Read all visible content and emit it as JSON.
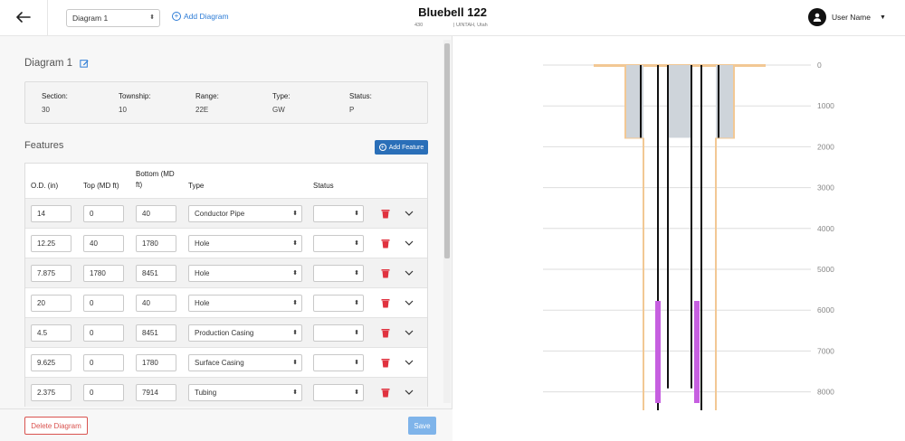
{
  "header": {
    "diagram_select": "Diagram 1",
    "add_diagram": "Add Diagram",
    "well_name": "Bluebell 122",
    "well_sub_left": "430",
    "well_sub_right": "| UINTAH, Utah",
    "user_name": "User Name"
  },
  "diagram": {
    "title": "Diagram 1",
    "info": [
      {
        "label": "Section:",
        "value": "30"
      },
      {
        "label": "Township:",
        "value": "10"
      },
      {
        "label": "Range:",
        "value": "22E"
      },
      {
        "label": "Type:",
        "value": "GW"
      },
      {
        "label": "Status:",
        "value": "P"
      }
    ]
  },
  "features": {
    "heading": "Features",
    "add_button": "Add Feature",
    "columns": {
      "od": "O.D. (in)",
      "top": "Top (MD ft)",
      "bottom_1": "Bottom (MD",
      "bottom_2": "ft)",
      "type": "Type",
      "status": "Status"
    },
    "rows": [
      {
        "od": "14",
        "top": "0",
        "bottom": "40",
        "type": "Conductor Pipe",
        "status": ""
      },
      {
        "od": "12.25",
        "top": "40",
        "bottom": "1780",
        "type": "Hole",
        "status": ""
      },
      {
        "od": "7.875",
        "top": "1780",
        "bottom": "8451",
        "type": "Hole",
        "status": ""
      },
      {
        "od": "20",
        "top": "0",
        "bottom": "40",
        "type": "Hole",
        "status": ""
      },
      {
        "od": "4.5",
        "top": "0",
        "bottom": "8451",
        "type": "Production Casing",
        "status": ""
      },
      {
        "od": "9.625",
        "top": "0",
        "bottom": "1780",
        "type": "Surface Casing",
        "status": ""
      },
      {
        "od": "2.375",
        "top": "0",
        "bottom": "7914",
        "type": "Tubing",
        "status": ""
      }
    ]
  },
  "footer": {
    "delete_label": "Delete Diagram",
    "save_label": "Save"
  },
  "wellbore": {
    "depth_labels": [
      "0",
      "1000",
      "2000",
      "3000",
      "4000",
      "5000",
      "6000",
      "7000",
      "8000"
    ],
    "colors": {
      "hole": "#f2c894",
      "cement": "#ced4da",
      "casing": "#111111",
      "perforation": "#c65fe0",
      "grid": "#dddddd"
    }
  },
  "icons": {
    "back": "arrow-left-icon",
    "add": "plus-circle-icon",
    "edit": "edit-icon",
    "avatar": "user-avatar-icon",
    "delete": "trash-icon",
    "expand": "chevron-down-icon"
  }
}
